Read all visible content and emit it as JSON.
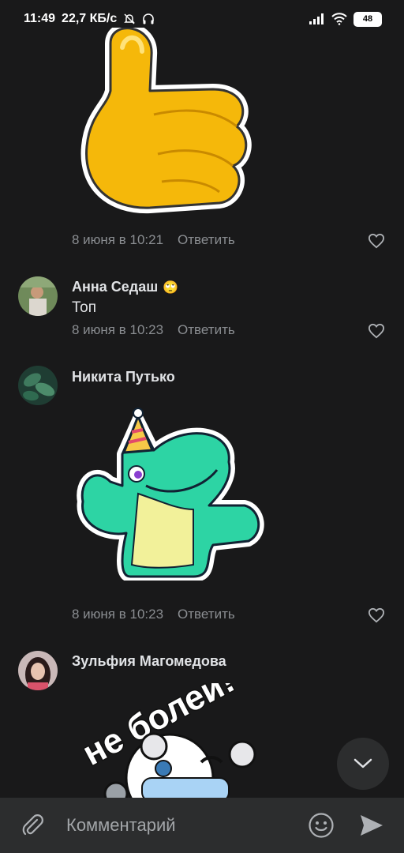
{
  "status_bar": {
    "time": "11:49",
    "network_speed": "22,7 КБ/с",
    "battery": "48"
  },
  "comments": [
    {
      "meta_date": "8 июня в 10:21",
      "reply_label": "Ответить",
      "sticker": "thumbs-up-sticker"
    },
    {
      "author": "Анна Седаш",
      "author_emoji": "🙄",
      "text": "Топ",
      "meta_date": "8 июня в 10:23",
      "reply_label": "Ответить"
    },
    {
      "author": "Никита Путько",
      "meta_date": "8 июня в 10:23",
      "reply_label": "Ответить",
      "sticker": "dino-thumbs-up-sticker"
    },
    {
      "author": "Зульфия Магомедова",
      "sticker_text": "не болей!",
      "sticker": "get-well-bear-sticker"
    }
  ],
  "composer": {
    "placeholder": "Комментарий"
  },
  "colors": {
    "background": "#19191a",
    "composer_bg": "#2c2d2e",
    "text_primary": "#e1e3e6",
    "text_secondary": "#8a8d91"
  }
}
